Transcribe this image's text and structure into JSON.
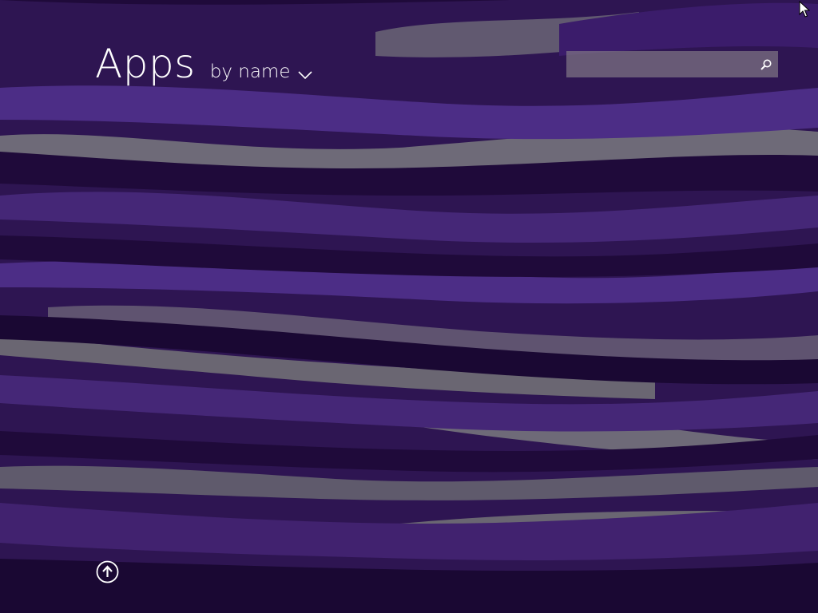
{
  "header": {
    "title": "Apps",
    "sort_label": "by name"
  },
  "search": {
    "value": "",
    "placeholder": ""
  },
  "icons": {
    "sort": "chevron-down-icon",
    "search": "search-icon",
    "scroll_up": "arrow-up-circle-icon",
    "cursor": "mouse-pointer-icon"
  },
  "colors": {
    "background": "#2e1552",
    "wave_dark": "#1f0a3a",
    "wave_mid": "#3b1c6b",
    "wave_light": "#4c2d86",
    "wave_highlight": "#6e6a78",
    "text": "#ffffff",
    "search_box": "#807684"
  }
}
